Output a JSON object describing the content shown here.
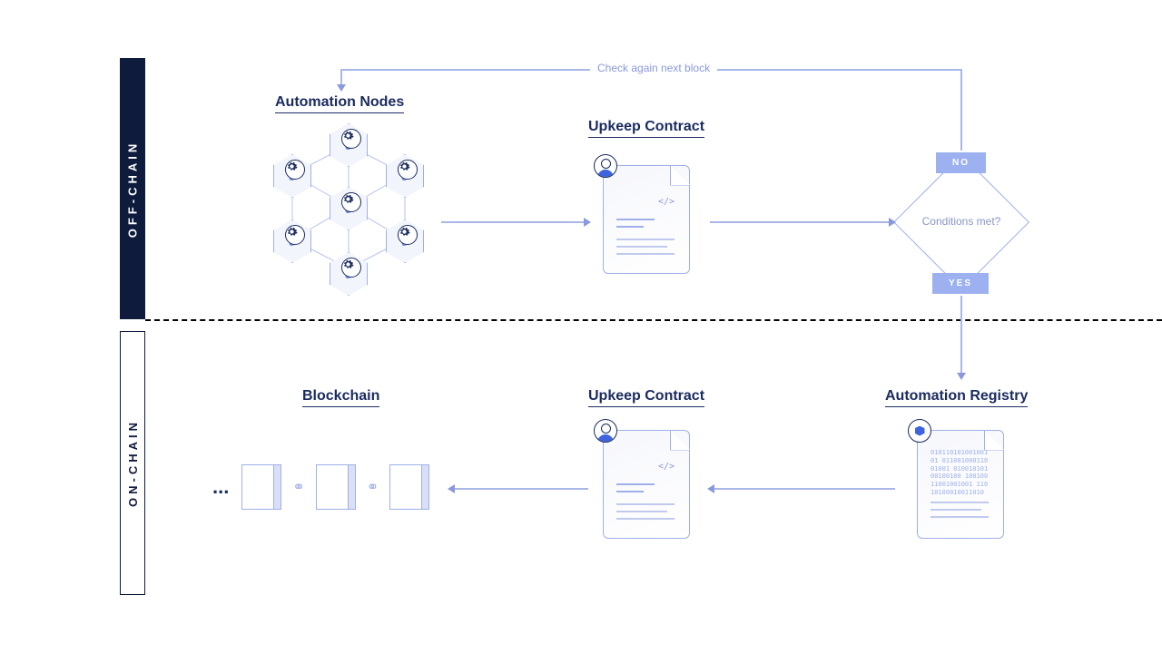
{
  "sidebar": {
    "offchain": "OFF-CHAIN",
    "onchain": "ON-CHAIN"
  },
  "titles": {
    "automation_nodes": "Automation Nodes",
    "upkeep_contract_top": "Upkeep Contract",
    "upkeep_contract_bottom": "Upkeep Contract",
    "automation_registry": "Automation Registry",
    "blockchain": "Blockchain"
  },
  "decision": {
    "question": "Conditions met?",
    "no": "NO",
    "yes": "YES"
  },
  "feedback": "Check again next block",
  "registry_binary": "01011010100100101 01100100011001001 01001010100100100 10010011001001001 11010100010011010",
  "ellipsis": "..."
}
